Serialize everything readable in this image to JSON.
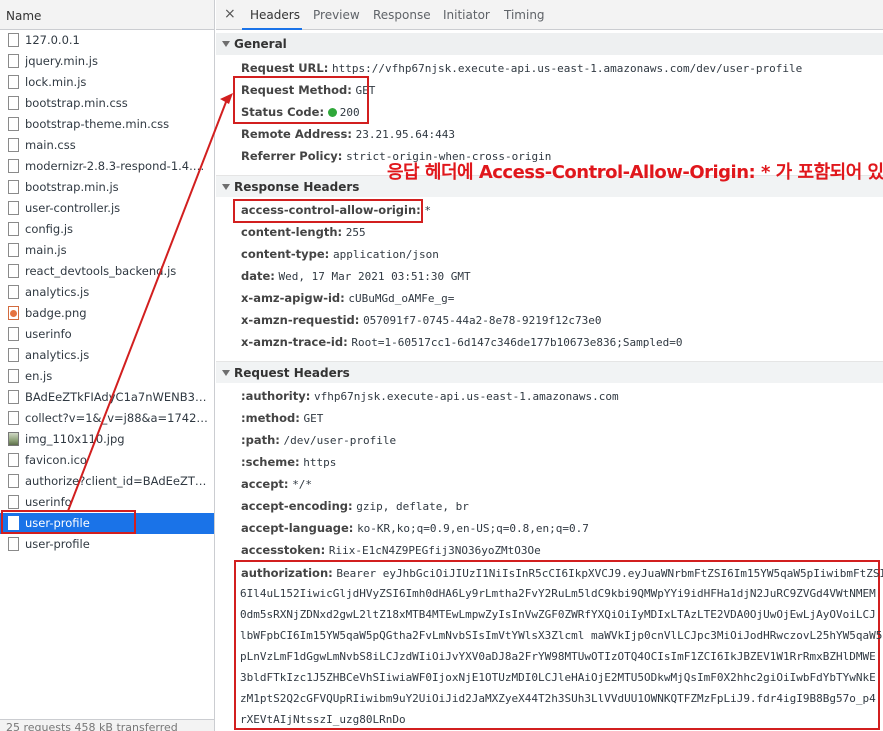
{
  "left_panel": {
    "header": "Name",
    "files": [
      {
        "name": "127.0.0.1",
        "icon": "doc-icon"
      },
      {
        "name": "jquery.min.js",
        "icon": "doc-icon"
      },
      {
        "name": "lock.min.js",
        "icon": "doc-icon"
      },
      {
        "name": "bootstrap.min.css",
        "icon": "doc-icon"
      },
      {
        "name": "bootstrap-theme.min.css",
        "icon": "doc-icon"
      },
      {
        "name": "main.css",
        "icon": "doc-icon"
      },
      {
        "name": "modernizr-2.8.3-respond-1.4.2.m...",
        "icon": "doc-icon"
      },
      {
        "name": "bootstrap.min.js",
        "icon": "doc-icon"
      },
      {
        "name": "user-controller.js",
        "icon": "doc-icon"
      },
      {
        "name": "config.js",
        "icon": "doc-icon"
      },
      {
        "name": "main.js",
        "icon": "doc-icon"
      },
      {
        "name": "react_devtools_backend.js",
        "icon": "doc-icon"
      },
      {
        "name": "analytics.js",
        "icon": "doc-icon"
      },
      {
        "name": "badge.png",
        "icon": "png-icon"
      },
      {
        "name": "userinfo",
        "icon": "doc-icon"
      },
      {
        "name": "analytics.js",
        "icon": "doc-icon"
      },
      {
        "name": "en.js",
        "icon": "doc-icon"
      },
      {
        "name": "BAdEeZTkFIAdyC1a7nWENB3sRy...",
        "icon": "doc-icon"
      },
      {
        "name": "collect?v=1&_v=j88&a=1742092...",
        "icon": "doc-icon"
      },
      {
        "name": "img_110x110.jpg",
        "icon": "image-icon"
      },
      {
        "name": "favicon.ico",
        "icon": "doc-icon"
      },
      {
        "name": "authorize?client_id=BAdEeZTkFI...",
        "icon": "doc-icon"
      },
      {
        "name": "userinfo",
        "icon": "doc-icon"
      },
      {
        "name": "user-profile",
        "icon": "doc-icon",
        "selected": true
      },
      {
        "name": "user-profile",
        "icon": "doc-icon"
      }
    ],
    "footer": "25 requests   458 kB transferred"
  },
  "tabs": {
    "close": "×",
    "items": [
      "Headers",
      "Preview",
      "Response",
      "Initiator",
      "Timing"
    ],
    "active": "Headers"
  },
  "general": {
    "title": "General",
    "request_url_key": "Request URL:",
    "request_url": "https://vfhp67njsk.execute-api.us-east-1.amazonaws.com/dev/user-profile",
    "request_method_key": "Request Method:",
    "request_method": "GET",
    "status_code_key": "Status Code:",
    "status_code": "200",
    "remote_address_key": "Remote Address:",
    "remote_address": "23.21.95.64:443",
    "referrer_policy_key": "Referrer Policy:",
    "referrer_policy": "strict-origin-when-cross-origin"
  },
  "response_headers": {
    "title": "Response Headers",
    "items": [
      {
        "k": "access-control-allow-origin:",
        "v": "*"
      },
      {
        "k": "content-length:",
        "v": "255"
      },
      {
        "k": "content-type:",
        "v": "application/json"
      },
      {
        "k": "date:",
        "v": "Wed, 17 Mar 2021 03:51:30 GMT"
      },
      {
        "k": "x-amz-apigw-id:",
        "v": "cUBuMGd_oAMFe_g="
      },
      {
        "k": "x-amzn-requestid:",
        "v": "057091f7-0745-44a2-8e78-9219f12c73e0"
      },
      {
        "k": "x-amzn-trace-id:",
        "v": "Root=1-60517cc1-6d147c346de177b10673e836;Sampled=0"
      }
    ]
  },
  "request_headers": {
    "title": "Request Headers",
    "items": [
      {
        "k": ":authority:",
        "v": "vfhp67njsk.execute-api.us-east-1.amazonaws.com"
      },
      {
        "k": ":method:",
        "v": "GET"
      },
      {
        "k": ":path:",
        "v": "/dev/user-profile"
      },
      {
        "k": ":scheme:",
        "v": "https"
      },
      {
        "k": "accept:",
        "v": "*/*"
      },
      {
        "k": "accept-encoding:",
        "v": "gzip, deflate, br"
      },
      {
        "k": "accept-language:",
        "v": "ko-KR,ko;q=0.9,en-US;q=0.8,en;q=0.7"
      },
      {
        "k": "accesstoken:",
        "v": "Riix-E1cN4Z9PEGfij3NO36yoZMtO3Oe"
      }
    ],
    "authorization_key": "authorization:",
    "authorization_lines": [
      "Bearer eyJhbGciOiJIUzI1NiIsInR5cCI6IkpXVCJ9.eyJuaWNrbmFtZSI6Im15YW5qaW5pIiwibmFtZSI",
      "6Il4uL152IiwicGljdHVyZSI6Imh0dHA6Ly9rLmtha2FvY2RuLm5ldC9kbi9QMWpYYi9idHFHa1djN2JuRC9ZVGd4VWtNMEM",
      "0dm5sRXNjZDNxd2gwL2ltZ18xMTB4MTEwLmpwZyIsInVwZGF0ZWRfYXQiOiIyMDIxLTAzLTE2VDA0OjUwOjEwLjAyOVoiLCJ",
      "lbWFpbCI6Im15YW5qaW5pQGtha2FvLmNvbSIsImVtYWlsX3Zlcml maWVkIjp0cnVlLCJpc3MiOiJodHRwczovL25hYW5qaW5",
      "pLnVzLmF1dGgwLmNvbS8iLCJzdWIiOiJvYXV0aDJ8a2FrYW98MTUwOTIzOTQ4OCIsImF1ZCI6IkJBZEV1W1RrRmxBZHlDMWE",
      "3bldFTkIzc1J5ZHBCeVhSIiwiaWF0IjoxNjE1OTUzMDI0LCJleHAiOjE2MTU5ODkwMjQsImF0X2hhc2giOiIwbFdYbTYwNkE",
      "zM1ptS2Q2cGFVQUpRIiwibm9uY2UiOiJid2JaMXZyeX44T2h3SUh3LlVVdUU1OWNKQTFZMzFpLiJ9.fdr4igI9B8Bg57o_p4",
      "rXEVtAIjNtsszI_uzg80LRnDo"
    ]
  },
  "annotation": {
    "text": "응답 헤더에 Access-Control-Allow-Origin: * 가 포함되어 있음",
    "color": "#e0171c"
  },
  "colors": {
    "selected_row": "#1a73e8",
    "annotation_red": "#d21f1f",
    "status_ok": "#2fa83a"
  }
}
